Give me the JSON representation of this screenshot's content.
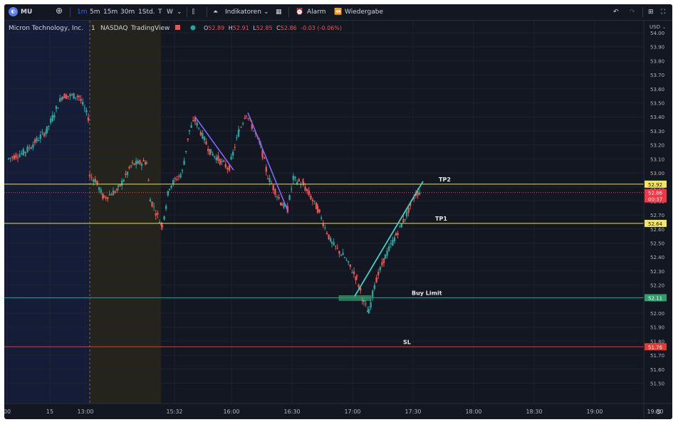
{
  "toolbar": {
    "symbol": "MU",
    "intervals": [
      "1m",
      "5m",
      "15m",
      "30m",
      "1Std.",
      "T",
      "W"
    ],
    "active_interval": "1m",
    "indicators": "Indikatoren",
    "alarm": "Alarm",
    "replay": "Wiedergabe"
  },
  "legend": {
    "name": "Micron Technology, Inc.",
    "interval": "1",
    "exchange": "NASDAQ",
    "source": "TradingView",
    "o_label": "O",
    "o": "52.89",
    "h_label": "H",
    "h": "52.91",
    "l_label": "L",
    "l": "52.85",
    "c_label": "C",
    "c": "52.86",
    "change": "-0.03 (-0.06%)"
  },
  "currency": "USD",
  "price_scale": {
    "min": 51.5,
    "max": 54.0,
    "step": 0.1,
    "ticks": [
      "54.00",
      "53.90",
      "53.80",
      "53.70",
      "53.60",
      "53.50",
      "53.40",
      "53.30",
      "53.20",
      "53.10",
      "53.00",
      "52.90",
      "52.80",
      "52.70",
      "52.60",
      "52.50",
      "52.40",
      "52.30",
      "52.20",
      "52.10",
      "52.00",
      "51.90",
      "51.80",
      "51.70",
      "51.60",
      "51.50"
    ]
  },
  "time_axis": [
    {
      "label": "00",
      "t": 0
    },
    {
      "label": "15",
      "t": 0.12
    },
    {
      "label": "13:00",
      "t": 0.22
    },
    {
      "label": "15:32",
      "t": 0.47
    },
    {
      "label": "16:00",
      "t": 0.63
    },
    {
      "label": "16:30",
      "t": 0.8
    },
    {
      "label": "17:00",
      "t": 0.97
    },
    {
      "label": "17:30",
      "t": 1.14
    },
    {
      "label": "18:00",
      "t": 1.31
    },
    {
      "label": "18:30",
      "t": 1.48
    },
    {
      "label": "19:00",
      "t": 1.65
    },
    {
      "label": "19:30",
      "t": 1.82
    }
  ],
  "levels": [
    {
      "name": "TP2",
      "label": "TP2",
      "price": 52.92,
      "badge": "52.92",
      "color": "#e6e15a",
      "badge_bg": "#f5e85c",
      "badge_fg": "#131722"
    },
    {
      "name": "TP1",
      "label": "TP1",
      "price": 52.64,
      "badge": "52.64",
      "color": "#e6e15a",
      "badge_bg": "#f5e85c",
      "badge_fg": "#131722"
    },
    {
      "name": "Buy Limit",
      "label": "Buy Limit",
      "price": 52.11,
      "badge": "52.11",
      "color": "#26a69a",
      "badge_bg": "#2e9e6a",
      "badge_fg": "#ffffff"
    },
    {
      "name": "SL",
      "label": "SL",
      "price": 51.76,
      "badge": "51.76",
      "color": "#e53935",
      "badge_bg": "#e53935",
      "badge_fg": "#ffffff"
    }
  ],
  "last_price": {
    "price": 52.86,
    "label": "52.86",
    "countdown": "00:37",
    "color": "#f23645"
  },
  "colors": {
    "up": "#26a69a",
    "down": "#ef5350",
    "bg": "#131722",
    "grid": "#1e2230",
    "trend_down": "#7b6cff",
    "trend_up": "#3fd3c4"
  }
}
